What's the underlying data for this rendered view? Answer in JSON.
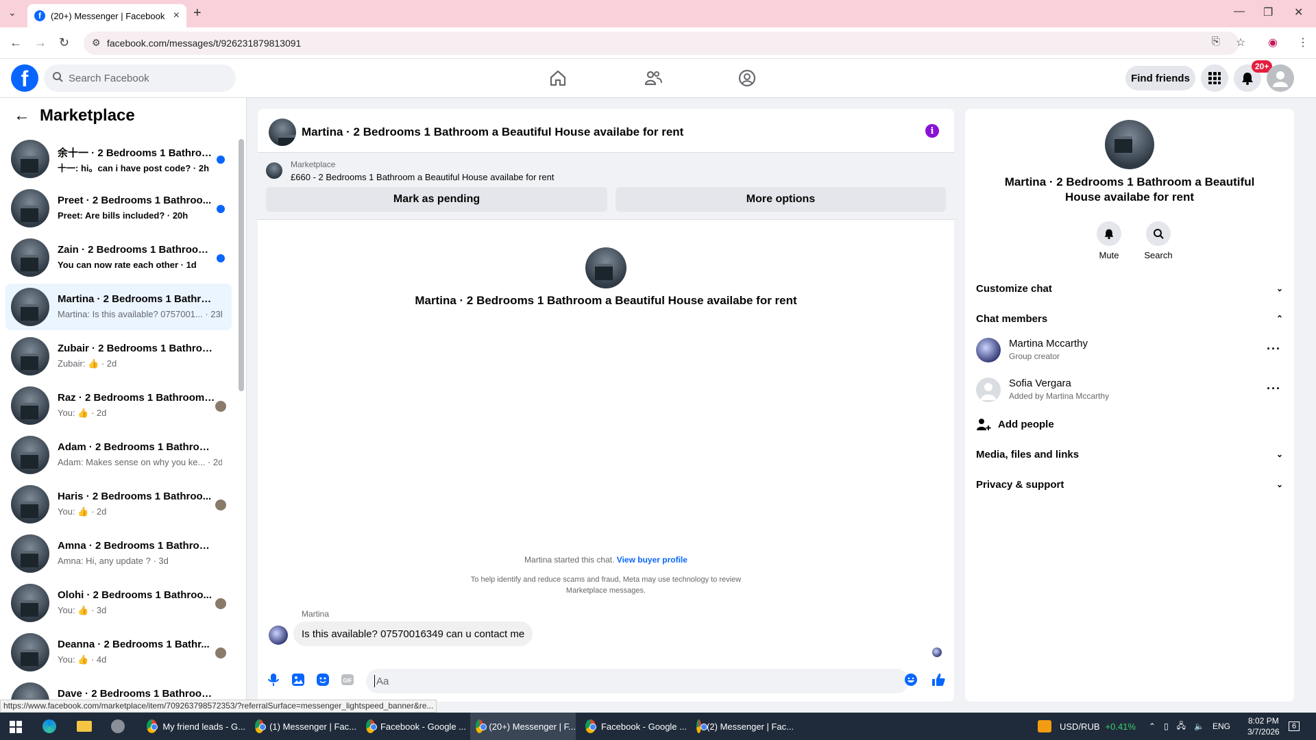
{
  "browser": {
    "tab_title": "(20+) Messenger | Facebook",
    "url": "facebook.com/messages/t/926231879813091",
    "status_url": "https://www.facebook.com/marketplace/item/709263798572353/?referralSurface=messenger_lightspeed_banner&re..."
  },
  "header": {
    "search_placeholder": "Search Facebook",
    "find_friends": "Find friends",
    "notif_badge": "20+"
  },
  "left": {
    "title": "Marketplace",
    "chats": [
      {
        "name": "余十一 · 2 Bedrooms 1 Bathroo...",
        "preview": "十一: hi。can i have post code? · 2h",
        "unread": true,
        "active": false,
        "indicator": "dot"
      },
      {
        "name": "Preet · 2 Bedrooms 1 Bathroo...",
        "preview": "Preet: Are bills included? · 20h",
        "unread": true,
        "active": false,
        "indicator": "dot"
      },
      {
        "name": "Zain · 2 Bedrooms 1 Bathroom...",
        "preview": "You can now rate each other · 1d",
        "unread": true,
        "active": false,
        "indicator": "dot"
      },
      {
        "name": "Martina · 2 Bedrooms 1 Bathroo...",
        "preview": "Martina: Is this available? 0757001... · 23h",
        "unread": false,
        "active": true,
        "indicator": "none"
      },
      {
        "name": "Zubair · 2 Bedrooms 1 Bathroom...",
        "preview": "Zubair: 👍 · 2d",
        "unread": false,
        "active": false,
        "indicator": "none"
      },
      {
        "name": "Raz · 2 Bedrooms 1 Bathroom ...",
        "preview": "You: 👍 · 2d",
        "unread": false,
        "active": false,
        "indicator": "seen"
      },
      {
        "name": "Adam · 2 Bedrooms 1 Bathroom ...",
        "preview": "Adam: Makes sense on why you ke... · 2d",
        "unread": false,
        "active": false,
        "indicator": "none"
      },
      {
        "name": "Haris · 2 Bedrooms 1 Bathroo...",
        "preview": "You: 👍 · 2d",
        "unread": false,
        "active": false,
        "indicator": "seen"
      },
      {
        "name": "Amna · 2 Bedrooms 1 Bathroom ...",
        "preview": "Amna: Hi, any update ? · 3d",
        "unread": false,
        "active": false,
        "indicator": "none"
      },
      {
        "name": "Olohi · 2 Bedrooms 1 Bathroo...",
        "preview": "You: 👍 · 3d",
        "unread": false,
        "active": false,
        "indicator": "seen"
      },
      {
        "name": "Deanna · 2 Bedrooms 1 Bathr...",
        "preview": "You: 👍 · 4d",
        "unread": false,
        "active": false,
        "indicator": "seen"
      },
      {
        "name": "Dave · 2 Bedrooms 1 Bathroom ...",
        "preview": "",
        "unread": false,
        "active": false,
        "indicator": "none"
      }
    ]
  },
  "conversation": {
    "title": "Martina · 2 Bedrooms 1 Bathroom a Beautiful House availabe for rent",
    "marketplace_label": "Marketplace",
    "listing": "£660 - 2 Bedrooms 1 Bathroom a Beautiful House availabe for rent",
    "mark_pending": "Mark as pending",
    "more_options": "More options",
    "started_text": "Martina started this chat.",
    "view_buyer": "View buyer profile",
    "disclaimer": "To help identify and reduce scams and fraud, Meta may use technology to review Marketplace messages.",
    "sender": "Martina",
    "message": "Is this available? 07570016349 can u contact me",
    "composer_placeholder": "Aa"
  },
  "right": {
    "title": "Martina · 2 Bedrooms 1 Bathroom a Beautiful House availabe for rent",
    "mute": "Mute",
    "search": "Search",
    "customize": "Customize chat",
    "members_header": "Chat members",
    "members": [
      {
        "name": "Martina Mccarthy",
        "role": "Group creator"
      },
      {
        "name": "Sofia Vergara",
        "role": "Added by Martina Mccarthy"
      }
    ],
    "add_people": "Add people",
    "media": "Media, files and links",
    "privacy": "Privacy & support"
  },
  "taskbar": {
    "items": [
      "My friend leads - G...",
      "(1) Messenger | Fac...",
      "Facebook - Google ...",
      "(20+) Messenger | F...",
      "Facebook - Google ...",
      "(2) Messenger | Fac..."
    ],
    "ticker": "USD/RUB",
    "ticker_change": "+0.41%",
    "lang": "ENG",
    "time": "8:02 PM",
    "date": "3/7/2026",
    "notif_count": "6"
  },
  "colors": {
    "brand": "#0866ff",
    "tab_bar": "#f9d1da",
    "active_chat": "#ebf5ff"
  }
}
